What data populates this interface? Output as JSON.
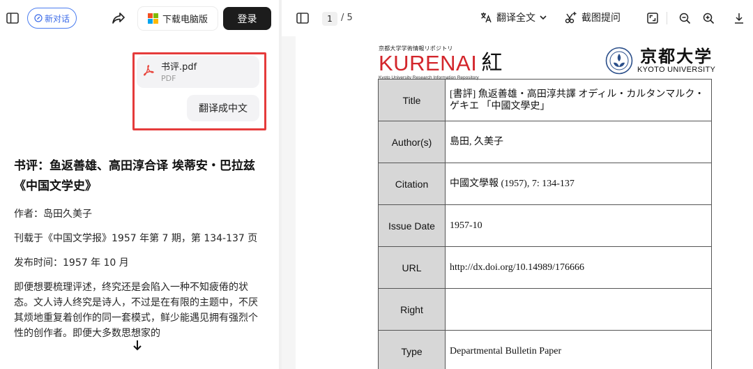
{
  "colors": {
    "accent_blue": "#3b6be8",
    "highlight_red": "#e53b3b",
    "pdf_red": "#e8453c",
    "kurenai_red": "#d3262c",
    "login_bg": "#1c1c1c"
  },
  "topbar": {
    "sidebar_icon": "sidebar-toggle-icon",
    "new_chat_label": "新对话",
    "share_icon": "share-arrow-icon",
    "download_label": "下载电脑版",
    "login_label": "登录"
  },
  "conversation": {
    "file": {
      "name": "书评.pdf",
      "type": "PDF"
    },
    "user_message": "翻译成中文"
  },
  "answer": {
    "title": "书评：鱼返善雄、高田淳合译 埃蒂安・巴拉兹《中国文学史》",
    "author": "作者：岛田久美子",
    "published_in": "刊载于《中国文学报》1957 年第 7 期，第 134-137 页",
    "release": "发布时间：1957 年 10 月",
    "body": "即便想要梳理评述，终究还是会陷入一种不知疲倦的状态。文人诗人终究是诗人，不过是在有限的主题中，不厌其烦地重复着创作的同一套模式，鲜少能遇见拥有强烈个性的创作者。即便大多数思想家的"
  },
  "pdf_toolbar": {
    "current_page": "1",
    "total_pages": "/ 5",
    "translate_label": "翻译全文",
    "screenshot_label": "截图提问",
    "icons": [
      "fit-page-icon",
      "zoom-out-icon",
      "zoom-in-icon",
      "download-icon"
    ]
  },
  "pdf_page": {
    "repo_top": "京都大学学術情報リポジトリ",
    "repo_name": "KURENAI",
    "repo_kanji": "紅",
    "repo_sub": "Kyoto University Research Information Repository",
    "univ_kanji": "京都大学",
    "univ_english": "KYOTO UNIVERSITY",
    "rows": [
      {
        "label": "Title",
        "value": "[書評] 魚返善雄・高田淳共譯 オディル・カルタンマルク・ゲキエ 「中國文學史」"
      },
      {
        "label": "Author(s)",
        "value": "島田, 久美子"
      },
      {
        "label": "Citation",
        "value": "中國文學報 (1957), 7: 134-137"
      },
      {
        "label": "Issue Date",
        "value": "1957-10"
      },
      {
        "label": "URL",
        "value": "http://dx.doi.org/10.14989/176666"
      },
      {
        "label": "Right",
        "value": ""
      },
      {
        "label": "Type",
        "value": "Departmental Bulletin Paper"
      }
    ]
  }
}
